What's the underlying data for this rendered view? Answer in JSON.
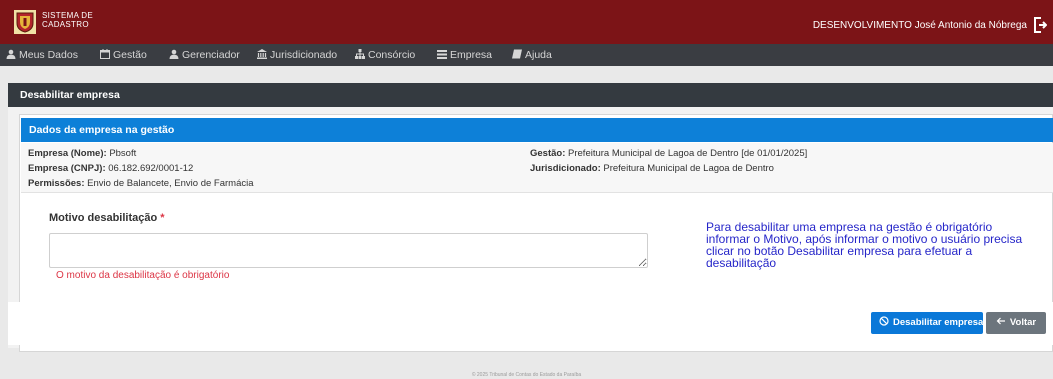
{
  "header": {
    "brand_line1": "SISTEMA DE",
    "brand_line2": "CADASTRO",
    "user_text": "DESENVOLVIMENTO José Antonio da Nóbrega"
  },
  "nav": {
    "items": [
      {
        "label": "Meus Dados",
        "icon": "user-icon"
      },
      {
        "label": "Gestão",
        "icon": "calendar-icon"
      },
      {
        "label": "Gerenciador",
        "icon": "user-icon"
      },
      {
        "label": "Jurisdicionado",
        "icon": "institution-icon"
      },
      {
        "label": "Consórcio",
        "icon": "sitemap-icon"
      },
      {
        "label": "Empresa",
        "icon": "list-icon"
      },
      {
        "label": "Ajuda",
        "icon": "book-icon"
      }
    ]
  },
  "page": {
    "title": "Desabilitar empresa",
    "section_title": "Dados da empresa na gestão"
  },
  "info": {
    "empresa_nome_label": "Empresa (Nome):",
    "empresa_nome_value": "Pbsoft",
    "empresa_cnpj_label": "Empresa (CNPJ):",
    "empresa_cnpj_value": "06.182.692/0001-12",
    "permissoes_label": "Permissões:",
    "permissoes_value": "Envio de Balancete, Envio de Farmácia",
    "gestao_label": "Gestão:",
    "gestao_value": "Prefeitura Municipal de Lagoa de Dentro [de 01/01/2025]",
    "jurisdicionado_label": "Jurisdicionado:",
    "jurisdicionado_value": "Prefeitura Municipal de Lagoa de Dentro"
  },
  "form": {
    "motivo_label": "Motivo desabilitação",
    "required_mark": "*",
    "motivo_value": "",
    "error_text": "O motivo da desabilitação é obrigatório",
    "help_text": "Para desabilitar uma empresa na gestão é obrigatório informar o Motivo, após informar o motivo o usuário precisa clicar no botão Desabilitar empresa para efetuar a desabilitação"
  },
  "actions": {
    "disable_label": "Desabilitar empresa",
    "back_label": "Voltar"
  },
  "footer": {
    "copyright": "© 2025 Tribunal de Contas do Estado da Paraíba"
  },
  "colors": {
    "topbar": "#7c1417",
    "navbar": "#3a3d42",
    "section_header": "#0d80d8",
    "primary_button": "#0a78d8",
    "secondary_button": "#6c757d",
    "error": "#dc3545",
    "help_text": "#2626c9"
  }
}
